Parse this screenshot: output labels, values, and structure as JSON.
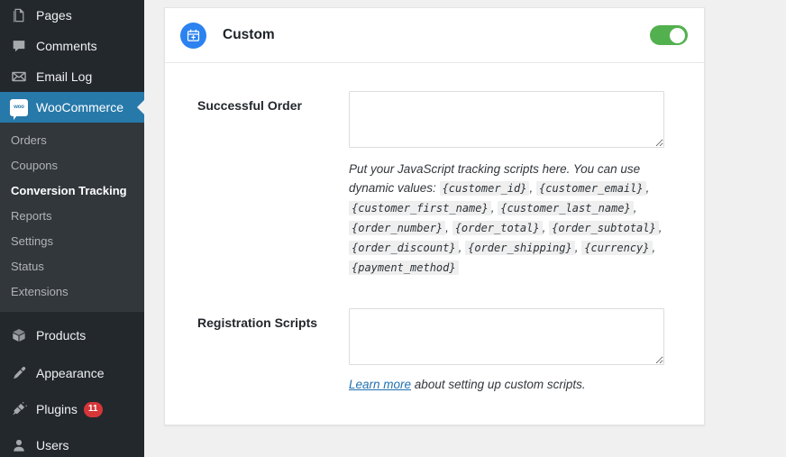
{
  "sidebar": {
    "items": [
      {
        "label": "Pages",
        "icon": "pages-icon",
        "state": "normal"
      },
      {
        "label": "Comments",
        "icon": "comments-icon",
        "state": "normal"
      },
      {
        "label": "Email Log",
        "icon": "email-log-icon",
        "state": "normal"
      },
      {
        "label": "WooCommerce",
        "icon": "woocommerce-icon",
        "state": "current"
      },
      {
        "label": "Products",
        "icon": "products-icon",
        "state": "normal"
      },
      {
        "label": "Appearance",
        "icon": "appearance-icon",
        "state": "normal"
      },
      {
        "label": "Plugins",
        "icon": "plugins-icon",
        "state": "normal",
        "badge": "11"
      },
      {
        "label": "Users",
        "icon": "users-icon",
        "state": "normal"
      }
    ],
    "submenu": [
      {
        "label": "Orders",
        "active": false
      },
      {
        "label": "Coupons",
        "active": false
      },
      {
        "label": "Conversion Tracking",
        "active": true
      },
      {
        "label": "Reports",
        "active": false
      },
      {
        "label": "Settings",
        "active": false
      },
      {
        "label": "Status",
        "active": false
      },
      {
        "label": "Extensions",
        "active": false
      }
    ],
    "badge_color": "#d63638",
    "current_color": "#2779aa"
  },
  "card": {
    "icon": "custom-script-calendar-icon",
    "icon_color": "#2b82f0",
    "title": "Custom",
    "toggle": {
      "state": "on",
      "color": "#53b04f"
    },
    "fields": [
      {
        "label": "Successful Order",
        "value": "",
        "placeholder": ""
      },
      {
        "label": "Registration Scripts",
        "value": "",
        "placeholder": ""
      }
    ],
    "help": {
      "lead": "Put your JavaScript tracking scripts here. You can use dynamic values:",
      "tokens": [
        "{customer_id}",
        "{customer_email}",
        "{customer_first_name}",
        "{customer_last_name}",
        "{order_number}",
        "{order_total}",
        "{order_subtotal}",
        "{order_discount}",
        "{order_shipping}",
        "{currency}",
        "{payment_method}"
      ]
    },
    "note": {
      "link_text": "Learn more",
      "rest_text": " about setting up custom scripts."
    }
  }
}
